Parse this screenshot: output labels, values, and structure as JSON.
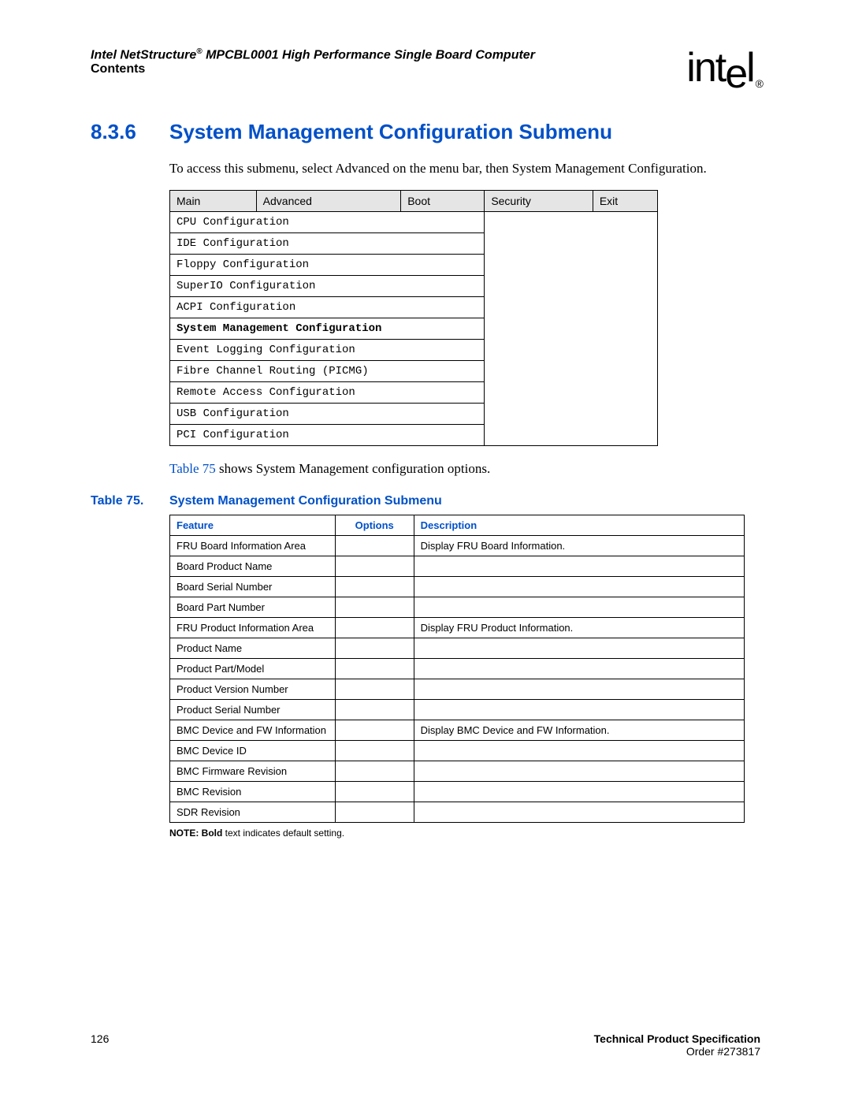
{
  "header": {
    "title_prefix": "Intel NetStructure",
    "title_reg": "®",
    "title_suffix": " MPCBL0001 High Performance Single Board Computer",
    "subtitle": "Contents",
    "logo_text": "intel",
    "logo_reg": "®"
  },
  "section": {
    "number": "8.3.6",
    "title": "System Management Configuration Submenu"
  },
  "intro_text": "To access this submenu, select Advanced on the menu bar, then System Management Configuration.",
  "menu": {
    "tabs": [
      "Main",
      "Advanced",
      "Boot",
      "Security",
      "Exit"
    ],
    "items": [
      {
        "label": "CPU Configuration",
        "bold": false
      },
      {
        "label": "IDE Configuration",
        "bold": false
      },
      {
        "label": "Floppy Configuration",
        "bold": false
      },
      {
        "label": "SuperIO Configuration",
        "bold": false
      },
      {
        "label": "ACPI Configuration",
        "bold": false
      },
      {
        "label": "System Management Configuration",
        "bold": true
      },
      {
        "label": "Event Logging Configuration",
        "bold": false
      },
      {
        "label": "Fibre Channel Routing (PICMG)",
        "bold": false
      },
      {
        "label": "Remote Access Configuration",
        "bold": false
      },
      {
        "label": "USB Configuration",
        "bold": false
      },
      {
        "label": "PCI Configuration",
        "bold": false
      }
    ]
  },
  "ref_text_link": "Table 75",
  "ref_text_rest": " shows System Management configuration options.",
  "table_caption": {
    "number": "Table 75.",
    "title": "System Management Configuration Submenu"
  },
  "table": {
    "headers": [
      "Feature",
      "Options",
      "Description"
    ],
    "rows": [
      {
        "feature": "FRU Board Information Area",
        "options": "",
        "description": "Display FRU Board Information."
      },
      {
        "feature": "Board Product Name",
        "options": "",
        "description": ""
      },
      {
        "feature": "Board Serial Number",
        "options": "",
        "description": ""
      },
      {
        "feature": "Board Part Number",
        "options": "",
        "description": ""
      },
      {
        "feature": "FRU Product Information Area",
        "options": "",
        "description": "Display FRU Product Information."
      },
      {
        "feature": "Product Name",
        "options": "",
        "description": ""
      },
      {
        "feature": "Product Part/Model",
        "options": "",
        "description": ""
      },
      {
        "feature": "Product Version Number",
        "options": "",
        "description": ""
      },
      {
        "feature": "Product Serial Number",
        "options": "",
        "description": ""
      },
      {
        "feature": "BMC Device and FW Information",
        "options": "",
        "description": "Display BMC Device and FW Information."
      },
      {
        "feature": "BMC Device ID",
        "options": "",
        "description": ""
      },
      {
        "feature": "BMC Firmware Revision",
        "options": "",
        "description": ""
      },
      {
        "feature": "BMC Revision",
        "options": "",
        "description": ""
      },
      {
        "feature": "SDR Revision",
        "options": "",
        "description": ""
      }
    ]
  },
  "note": {
    "prefix": "NOTE: ",
    "bold": "Bold",
    "suffix": " text indicates default setting."
  },
  "footer": {
    "page": "126",
    "right1": "Technical Product Specification",
    "right2": "Order #273817"
  }
}
